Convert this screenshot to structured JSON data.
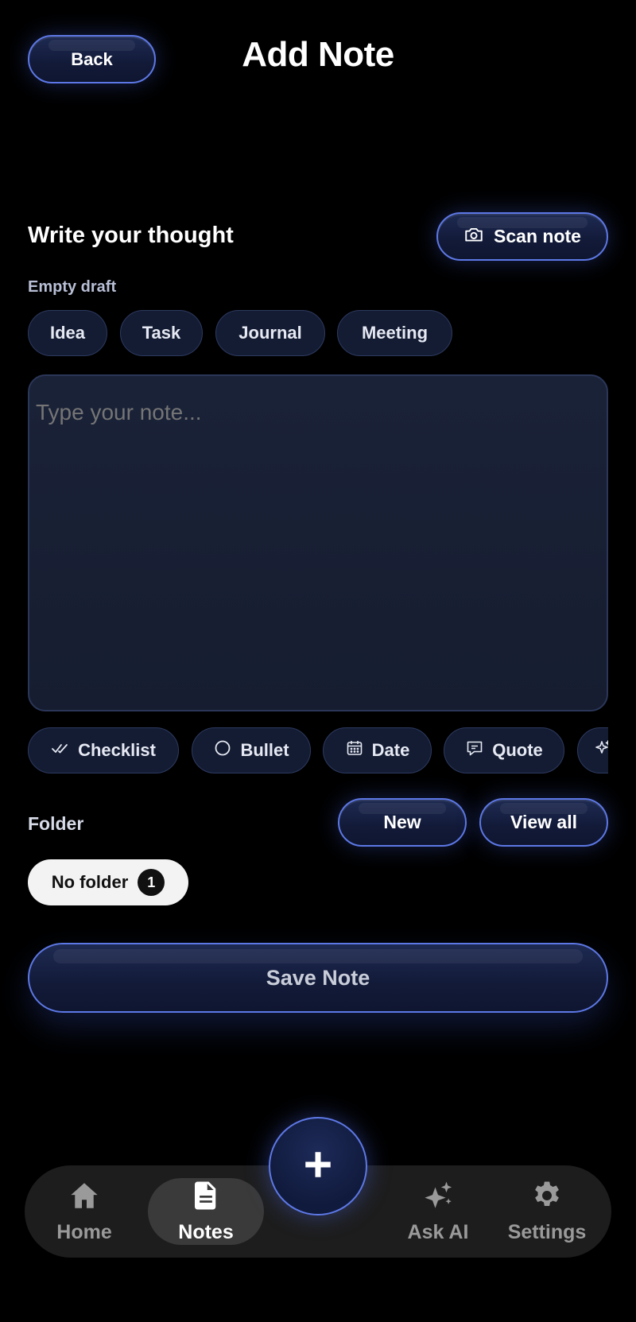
{
  "header": {
    "back_label": "Back",
    "title": "Add Note"
  },
  "composer": {
    "section_title": "Write your thought",
    "scan_label": "Scan note",
    "draft_status": "Empty draft",
    "templates": [
      "Idea",
      "Task",
      "Journal",
      "Meeting"
    ],
    "note_placeholder": "Type your note...",
    "note_value": ""
  },
  "tools": [
    {
      "label": "Checklist",
      "icon": "checklist-icon"
    },
    {
      "label": "Bullet",
      "icon": "circle-icon"
    },
    {
      "label": "Date",
      "icon": "calendar-icon"
    },
    {
      "label": "Quote",
      "icon": "speech-bubble-icon"
    },
    {
      "label": "",
      "icon": "sparkle-icon"
    }
  ],
  "folder": {
    "label": "Folder",
    "new_label": "New",
    "view_all_label": "View all",
    "selected": "No folder",
    "selected_count": "1"
  },
  "save_label": "Save Note",
  "bottom_nav": {
    "items": [
      {
        "label": "Home",
        "icon": "home-icon"
      },
      {
        "label": "Notes",
        "icon": "document-icon",
        "active": true
      },
      {
        "label": "Ask AI",
        "icon": "sparkles-icon"
      },
      {
        "label": "Settings",
        "icon": "gear-icon"
      }
    ],
    "fab_icon": "plus-icon"
  },
  "colors": {
    "background": "#000000",
    "accent_border": "#5d78e6",
    "button_fill": "#121a38",
    "chip_fill": "#141c33",
    "nav_bar": "#1d1d1d"
  }
}
